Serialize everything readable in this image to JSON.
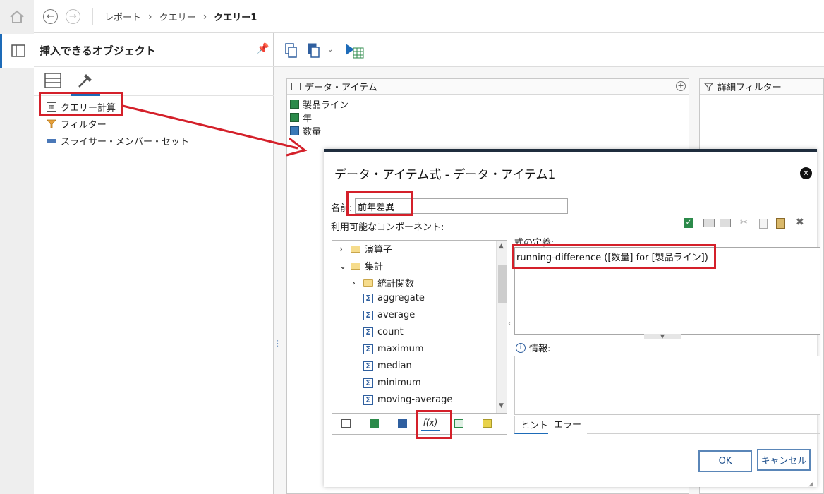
{
  "breadcrumb": {
    "items": [
      "レポート",
      "クエリー",
      "クエリー1"
    ]
  },
  "objects_panel": {
    "title": "挿入できるオブジェクト",
    "items": [
      {
        "label": "クエリー計算",
        "icon": "query-calc-icon"
      },
      {
        "label": "フィルター",
        "icon": "filter-funnel-icon"
      },
      {
        "label": "スライサー・メンバー・セット",
        "icon": "slicer-icon"
      }
    ]
  },
  "data_items_panel": {
    "title": "データ・アイテム",
    "rows": [
      "製品ライン",
      "年",
      "数量"
    ]
  },
  "filters_panel": {
    "title": "詳細フィルター"
  },
  "dialog": {
    "title": "データ・アイテム式 - データ・アイテム1",
    "name_label": "名前:",
    "name_value": "前年差異",
    "components_label": "利用可能なコンポーネント:",
    "expression_label": "式の定義:",
    "expression": "running-difference ([数量] for [製品ライン])",
    "info_label": "情報:",
    "tabs": [
      "ヒント",
      "エラー"
    ],
    "ok": "OK",
    "cancel": "キャンセル",
    "tree": [
      {
        "label": "演算子",
        "type": "folder",
        "expanded": false,
        "level": 0
      },
      {
        "label": "集計",
        "type": "folder",
        "expanded": true,
        "level": 0
      },
      {
        "label": "統計関数",
        "type": "folder",
        "expanded": false,
        "level": 1
      },
      {
        "label": "aggregate",
        "type": "function",
        "level": 2
      },
      {
        "label": "average",
        "type": "function",
        "level": 2
      },
      {
        "label": "count",
        "type": "function",
        "level": 2
      },
      {
        "label": "maximum",
        "type": "function",
        "level": 2
      },
      {
        "label": "median",
        "type": "function",
        "level": 2
      },
      {
        "label": "minimum",
        "type": "function",
        "level": 2
      },
      {
        "label": "moving-average",
        "type": "function",
        "level": 2
      }
    ],
    "component_tab_fx": "f(x)"
  },
  "colors": {
    "highlight": "#d4202a",
    "accent": "#1d6bb8",
    "dialog_border": "#1f2d3d"
  }
}
